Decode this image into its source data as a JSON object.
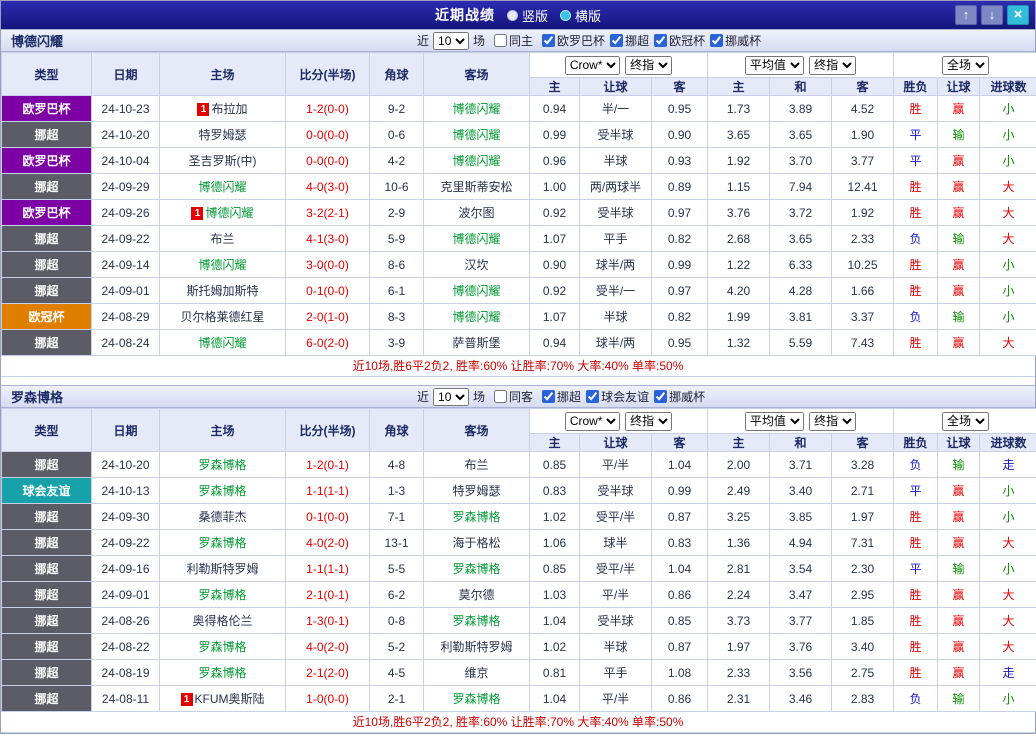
{
  "title_bar": {
    "title": "近期战绩",
    "layout_options": {
      "vertical": {
        "label": "竖版",
        "selected": false
      },
      "horizontal": {
        "label": "横版",
        "selected": true
      }
    },
    "up_icon": "↑",
    "down_icon": "↓",
    "close_icon": "×"
  },
  "ui": {
    "near_label": "近",
    "games_label": "场"
  },
  "selects": {
    "asia_source": "Crow*",
    "stage": "终指",
    "euro_source": "平均值",
    "scope": "全场"
  },
  "table_header": {
    "cols": [
      "类型",
      "日期",
      "主场",
      "比分(半场)",
      "角球",
      "客场"
    ],
    "sub": [
      "主",
      "让球",
      "客",
      "主",
      "和",
      "客",
      "胜负",
      "让球",
      "进球数"
    ]
  },
  "colors": {
    "league": {
      "欧罗巴杯": "#7d00a5",
      "挪超": "#5c5c66",
      "欧冠杯": "#e07e00",
      "球会友谊": "#17a2ab"
    },
    "result": {
      "胜": "#e60000",
      "平": "#1414cc",
      "负": "#1414cc"
    },
    "handicap": {
      "赢": "#e60000",
      "输": "#089000",
      "走": "#1414cc"
    },
    "goals": {
      "大": "#e60000",
      "小": "#089000",
      "走": "#1414cc"
    },
    "focus_team": "#009933",
    "score": "#e60000"
  },
  "sections": [
    {
      "team": "博德闪耀",
      "filters": {
        "count": "10",
        "same_label": "同主",
        "same_checked": false,
        "leagues": [
          {
            "label": "欧罗巴杯",
            "checked": true
          },
          {
            "label": "挪超",
            "checked": true
          },
          {
            "label": "欧冠杯",
            "checked": true
          },
          {
            "label": "挪威杯",
            "checked": true
          }
        ]
      },
      "rows": [
        {
          "league": "欧罗巴杯",
          "date": "24-10-23",
          "home": "布拉加",
          "home_badge": "1",
          "score": "1-2(0-0)",
          "corner": "9-2",
          "away": "博德闪耀",
          "away_focus": true,
          "asia": [
            "0.94",
            "半/一",
            "0.95"
          ],
          "euro": [
            "1.73",
            "3.89",
            "4.52"
          ],
          "result": "胜",
          "handicap_result": "赢",
          "goals": "小"
        },
        {
          "league": "挪超",
          "date": "24-10-20",
          "home": "特罗姆瑟",
          "score": "0-0(0-0)",
          "corner": "0-6",
          "away": "博德闪耀",
          "away_focus": true,
          "asia": [
            "0.99",
            "受半球",
            "0.90"
          ],
          "euro": [
            "3.65",
            "3.65",
            "1.90"
          ],
          "result": "平",
          "handicap_result": "输",
          "goals": "小"
        },
        {
          "league": "欧罗巴杯",
          "date": "24-10-04",
          "home": "圣吉罗斯(中)",
          "score": "0-0(0-0)",
          "corner": "4-2",
          "away": "博德闪耀",
          "away_focus": true,
          "asia": [
            "0.96",
            "半球",
            "0.93"
          ],
          "euro": [
            "1.92",
            "3.70",
            "3.77"
          ],
          "result": "平",
          "handicap_result": "赢",
          "goals": "小"
        },
        {
          "league": "挪超",
          "date": "24-09-29",
          "home": "博德闪耀",
          "home_focus": true,
          "score": "4-0(3-0)",
          "corner": "10-6",
          "away": "克里斯蒂安松",
          "asia": [
            "1.00",
            "两/两球半",
            "0.89"
          ],
          "euro": [
            "1.15",
            "7.94",
            "12.41"
          ],
          "result": "胜",
          "handicap_result": "赢",
          "goals": "大"
        },
        {
          "league": "欧罗巴杯",
          "date": "24-09-26",
          "home": "博德闪耀",
          "home_badge": "1",
          "home_focus": true,
          "score": "3-2(2-1)",
          "corner": "2-9",
          "away": "波尔图",
          "asia": [
            "0.92",
            "受半球",
            "0.97"
          ],
          "euro": [
            "3.76",
            "3.72",
            "1.92"
          ],
          "result": "胜",
          "handicap_result": "赢",
          "goals": "大"
        },
        {
          "league": "挪超",
          "date": "24-09-22",
          "home": "布兰",
          "score": "4-1(3-0)",
          "corner": "5-9",
          "away": "博德闪耀",
          "away_focus": true,
          "asia": [
            "1.07",
            "平手",
            "0.82"
          ],
          "euro": [
            "2.68",
            "3.65",
            "2.33"
          ],
          "result": "负",
          "handicap_result": "输",
          "goals": "大"
        },
        {
          "league": "挪超",
          "date": "24-09-14",
          "home": "博德闪耀",
          "home_focus": true,
          "score": "3-0(0-0)",
          "corner": "8-6",
          "away": "汉坎",
          "asia": [
            "0.90",
            "球半/两",
            "0.99"
          ],
          "euro": [
            "1.22",
            "6.33",
            "10.25"
          ],
          "result": "胜",
          "handicap_result": "赢",
          "goals": "小"
        },
        {
          "league": "挪超",
          "date": "24-09-01",
          "home": "斯托姆加斯特",
          "score": "0-1(0-0)",
          "corner": "6-1",
          "away": "博德闪耀",
          "away_focus": true,
          "asia": [
            "0.92",
            "受半/一",
            "0.97"
          ],
          "euro": [
            "4.20",
            "4.28",
            "1.66"
          ],
          "result": "胜",
          "handicap_result": "赢",
          "goals": "小"
        },
        {
          "league": "欧冠杯",
          "date": "24-08-29",
          "home": "贝尔格莱德红星",
          "score": "2-0(1-0)",
          "corner": "8-3",
          "away": "博德闪耀",
          "away_focus": true,
          "asia": [
            "1.07",
            "半球",
            "0.82"
          ],
          "euro": [
            "1.99",
            "3.81",
            "3.37"
          ],
          "result": "负",
          "handicap_result": "输",
          "goals": "小"
        },
        {
          "league": "挪超",
          "date": "24-08-24",
          "home": "博德闪耀",
          "home_focus": true,
          "score": "6-0(2-0)",
          "corner": "3-9",
          "away": "萨普斯堡",
          "asia": [
            "0.94",
            "球半/两",
            "0.95"
          ],
          "euro": [
            "1.32",
            "5.59",
            "7.43"
          ],
          "result": "胜",
          "handicap_result": "赢",
          "goals": "大"
        }
      ],
      "summary": "近10场,胜6平2负2, 胜率:60% 让胜率:70% 大率:40% 单率:50%"
    },
    {
      "team": "罗森博格",
      "filters": {
        "count": "10",
        "same_label": "同客",
        "same_checked": false,
        "leagues": [
          {
            "label": "挪超",
            "checked": true
          },
          {
            "label": "球会友谊",
            "checked": true
          },
          {
            "label": "挪威杯",
            "checked": true
          }
        ]
      },
      "rows": [
        {
          "league": "挪超",
          "date": "24-10-20",
          "home": "罗森博格",
          "home_focus": true,
          "score": "1-2(0-1)",
          "corner": "4-8",
          "away": "布兰",
          "asia": [
            "0.85",
            "平/半",
            "1.04"
          ],
          "euro": [
            "2.00",
            "3.71",
            "3.28"
          ],
          "result": "负",
          "handicap_result": "输",
          "goals": "走"
        },
        {
          "league": "球会友谊",
          "date": "24-10-13",
          "home": "罗森博格",
          "home_focus": true,
          "score": "1-1(1-1)",
          "corner": "1-3",
          "away": "特罗姆瑟",
          "asia": [
            "0.83",
            "受半球",
            "0.99"
          ],
          "euro": [
            "2.49",
            "3.40",
            "2.71"
          ],
          "result": "平",
          "handicap_result": "赢",
          "goals": "小"
        },
        {
          "league": "挪超",
          "date": "24-09-30",
          "home": "桑德菲杰",
          "score": "0-1(0-0)",
          "corner": "7-1",
          "away": "罗森博格",
          "away_focus": true,
          "asia": [
            "1.02",
            "受平/半",
            "0.87"
          ],
          "euro": [
            "3.25",
            "3.85",
            "1.97"
          ],
          "result": "胜",
          "handicap_result": "赢",
          "goals": "小"
        },
        {
          "league": "挪超",
          "date": "24-09-22",
          "home": "罗森博格",
          "home_focus": true,
          "score": "4-0(2-0)",
          "corner": "13-1",
          "away": "海于格松",
          "asia": [
            "1.06",
            "球半",
            "0.83"
          ],
          "euro": [
            "1.36",
            "4.94",
            "7.31"
          ],
          "result": "胜",
          "handicap_result": "赢",
          "goals": "大"
        },
        {
          "league": "挪超",
          "date": "24-09-16",
          "home": "利勒斯特罗姆",
          "score": "1-1(1-1)",
          "corner": "5-5",
          "away": "罗森博格",
          "away_focus": true,
          "asia": [
            "0.85",
            "受平/半",
            "1.04"
          ],
          "euro": [
            "2.81",
            "3.54",
            "2.30"
          ],
          "result": "平",
          "handicap_result": "输",
          "goals": "小"
        },
        {
          "league": "挪超",
          "date": "24-09-01",
          "home": "罗森博格",
          "home_focus": true,
          "score": "2-1(0-1)",
          "corner": "6-2",
          "away": "莫尔德",
          "asia": [
            "1.03",
            "平/半",
            "0.86"
          ],
          "euro": [
            "2.24",
            "3.47",
            "2.95"
          ],
          "result": "胜",
          "handicap_result": "赢",
          "goals": "大"
        },
        {
          "league": "挪超",
          "date": "24-08-26",
          "home": "奥得格伦兰",
          "score": "1-3(0-1)",
          "corner": "0-8",
          "away": "罗森博格",
          "away_focus": true,
          "asia": [
            "1.04",
            "受半球",
            "0.85"
          ],
          "euro": [
            "3.73",
            "3.77",
            "1.85"
          ],
          "result": "胜",
          "handicap_result": "赢",
          "goals": "大"
        },
        {
          "league": "挪超",
          "date": "24-08-22",
          "home": "罗森博格",
          "home_focus": true,
          "score": "4-0(2-0)",
          "corner": "5-2",
          "away": "利勒斯特罗姆",
          "asia": [
            "1.02",
            "半球",
            "0.87"
          ],
          "euro": [
            "1.97",
            "3.76",
            "3.40"
          ],
          "result": "胜",
          "handicap_result": "赢",
          "goals": "大"
        },
        {
          "league": "挪超",
          "date": "24-08-19",
          "home": "罗森博格",
          "home_focus": true,
          "score": "2-1(2-0)",
          "corner": "4-5",
          "away": "维京",
          "asia": [
            "0.81",
            "平手",
            "1.08"
          ],
          "euro": [
            "2.33",
            "3.56",
            "2.75"
          ],
          "result": "胜",
          "handicap_result": "赢",
          "goals": "走"
        },
        {
          "league": "挪超",
          "date": "24-08-11",
          "home": "KFUM奥斯陆",
          "home_badge": "1",
          "score": "1-0(0-0)",
          "corner": "2-1",
          "away": "罗森博格",
          "away_focus": true,
          "asia": [
            "1.04",
            "平/半",
            "0.86"
          ],
          "euro": [
            "2.31",
            "3.46",
            "2.83"
          ],
          "result": "负",
          "handicap_result": "输",
          "goals": "小"
        }
      ],
      "summary": "近10场,胜6平2负2, 胜率:60% 让胜率:70% 大率:40% 单率:50%"
    }
  ]
}
